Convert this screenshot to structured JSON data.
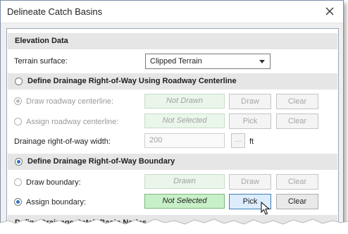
{
  "window": {
    "title": "Delineate Catch Basins",
    "close_icon": "close-icon"
  },
  "elevation": {
    "header": "Elevation Data",
    "terrain_label": "Terrain surface:",
    "terrain_value": "Clipped Terrain"
  },
  "centerline": {
    "header": "Define Drainage Right-of-Way Using Roadway Centerline",
    "selected": false,
    "draw_label": "Draw roadway centerline:",
    "draw_status": "Not Drawn",
    "draw_button": "Draw",
    "draw_clear": "Clear",
    "assign_label": "Assign roadway centerline:",
    "assign_status": "Not Selected",
    "assign_button": "Pick",
    "assign_clear": "Clear",
    "width_label": "Drainage right-of-way width:",
    "width_value": "200",
    "width_button": "...",
    "width_unit": "ft"
  },
  "boundary": {
    "header": "Define Drainage Right-of-Way Boundary",
    "selected": true,
    "draw_label": "Draw boundary:",
    "draw_status": "Drawn",
    "draw_button": "Draw",
    "draw_clear": "Clear",
    "assign_label": "Assign boundary:",
    "assign_status": "Not Selected",
    "assign_button": "Pick",
    "assign_clear": "Clear",
    "assign_selected": true
  },
  "nodes": {
    "header_partial": "Define Drainage Catch Basin Nodes"
  },
  "colors": {
    "active_status": "#c8f0c8",
    "accent": "#3c7fb1",
    "section_bg": "#e6e6e6"
  }
}
